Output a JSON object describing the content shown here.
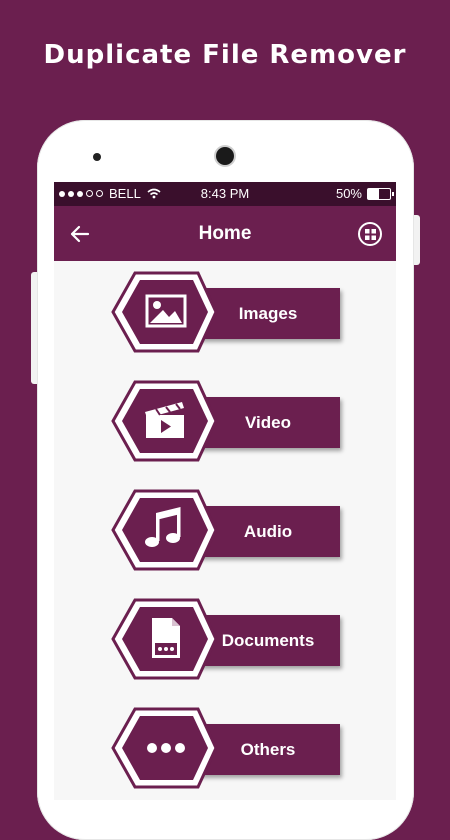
{
  "promo": {
    "title": "Duplicate File Remover"
  },
  "status_bar": {
    "carrier": "BELL",
    "time": "8:43 PM",
    "battery": "50%",
    "battery_level": 0.5
  },
  "app_bar": {
    "title": "Home",
    "back_icon": "arrow-left-icon",
    "grid_icon": "grid-icon"
  },
  "menu": [
    {
      "label": "Images",
      "icon": "image-icon"
    },
    {
      "label": "Video",
      "icon": "clapperboard-icon"
    },
    {
      "label": "Audio",
      "icon": "music-note-icon"
    },
    {
      "label": "Documents",
      "icon": "document-icon"
    },
    {
      "label": "Others",
      "icon": "more-dots-icon"
    }
  ],
  "colors": {
    "brand": "#6b1f4f",
    "status_bar": "#3a0f2c",
    "screen_bg": "#f7f7f7"
  }
}
